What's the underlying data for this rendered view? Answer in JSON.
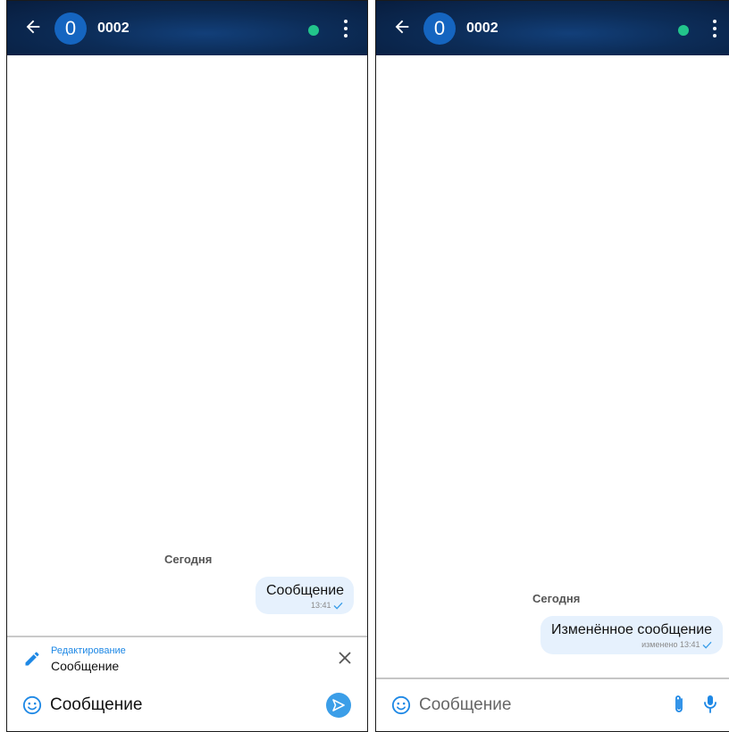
{
  "left_screen": {
    "header": {
      "avatar_letter": "0",
      "title": "0002"
    },
    "date_separator": "Сегодня",
    "message": {
      "text": "Сообщение",
      "time": "13:41"
    },
    "edit_bar": {
      "label": "Редактирование",
      "text": "Сообщение"
    },
    "input": {
      "value": "Сообщение"
    }
  },
  "right_screen": {
    "header": {
      "avatar_letter": "0",
      "title": "0002"
    },
    "date_separator": "Сегодня",
    "message": {
      "text": "Изменённое сообщение",
      "meta": "изменено 13:41"
    },
    "input": {
      "placeholder": "Сообщение"
    }
  },
  "colors": {
    "accent": "#1e88e5",
    "online": "#22c58b",
    "bubble": "#e6f1fd",
    "avatar": "#1565c0"
  },
  "icons": [
    "back-arrow-icon",
    "more-vert-icon",
    "pencil-icon",
    "close-icon",
    "emoji-icon",
    "send-icon",
    "paperclip-icon",
    "microphone-icon",
    "check-icon"
  ]
}
